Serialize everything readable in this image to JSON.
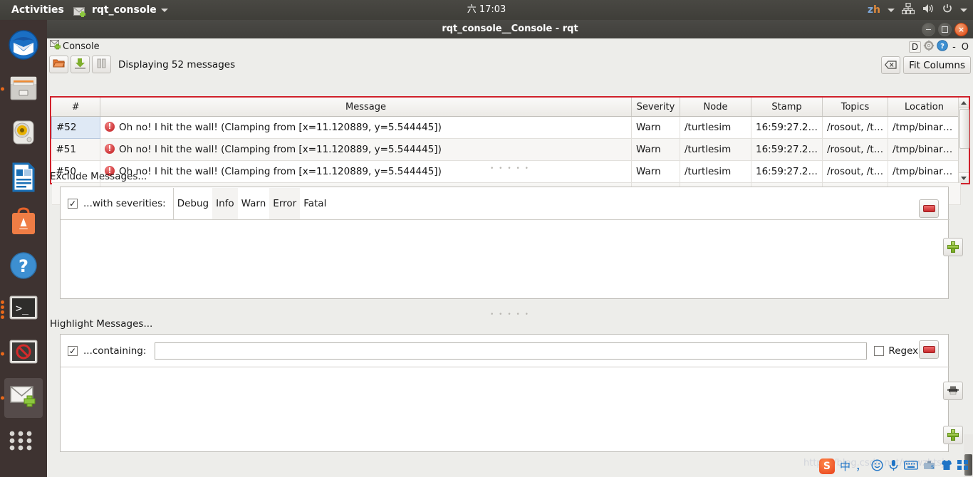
{
  "top_panel": {
    "activities": "Activities",
    "app_name": "rqt_console",
    "app_icon": "mail-add-icon",
    "clock": "六 17:03",
    "language": "zh",
    "tray_icons": [
      "network-icon",
      "volume-icon",
      "power-icon"
    ]
  },
  "launcher": {
    "items": [
      {
        "name": "thunderbird",
        "icon": "thunderbird-icon",
        "running": false,
        "current": false
      },
      {
        "name": "files",
        "icon": "file-manager-icon",
        "running": true,
        "current": false
      },
      {
        "name": "rhythmbox",
        "icon": "rhythmbox-icon",
        "running": false,
        "current": false
      },
      {
        "name": "libreoffice",
        "icon": "libreoffice-writer-icon",
        "running": false,
        "current": false
      },
      {
        "name": "ubuntu-software",
        "icon": "ubuntu-software-icon",
        "running": false,
        "current": false
      },
      {
        "name": "help",
        "icon": "help-icon",
        "running": false,
        "current": false
      },
      {
        "name": "terminal",
        "icon": "terminal-icon",
        "running": true,
        "current": false
      },
      {
        "name": "blocked-app",
        "icon": "no-entry-icon",
        "running": true,
        "current": false
      },
      {
        "name": "rqt-console",
        "icon": "mail-add-icon",
        "running": true,
        "current": true
      },
      {
        "name": "show-applications",
        "icon": "apps-grid-icon",
        "running": false,
        "current": false
      }
    ]
  },
  "window": {
    "title": "rqt_console__Console - rqt",
    "controls": {
      "minimize": "minimize-button",
      "maximize": "maximize-button",
      "close": "close-button"
    }
  },
  "dock": {
    "tab_label": "Console",
    "tab_icon": "mail-add-icon",
    "right_icons": [
      "D",
      "gear-icon",
      "help-icon"
    ],
    "minimize_label": "-",
    "close_label": "O"
  },
  "toolbar": {
    "open_label": "open-icon",
    "save_label": "save-icon",
    "pause_label": "pause-icon",
    "status": "Displaying 52 messages",
    "clear_label": "clear-icon",
    "fit_columns": "Fit Columns"
  },
  "table": {
    "columns": [
      "#",
      "Message",
      "Severity",
      "Node",
      "Stamp",
      "Topics",
      "Location"
    ],
    "rows": [
      {
        "num": "#52",
        "message": "Oh no! I hit the wall! (Clamping from [x=11.120889, y=5.544445])",
        "severity": "Warn",
        "node": "/turtlesim",
        "stamp": "16:59:27.2…",
        "topics": "/rosout, /t…",
        "location": "/tmp/binar…",
        "selected": true
      },
      {
        "num": "#51",
        "message": "Oh no! I hit the wall! (Clamping from [x=11.120889, y=5.544445])",
        "severity": "Warn",
        "node": "/turtlesim",
        "stamp": "16:59:27.2…",
        "topics": "/rosout, /t…",
        "location": "/tmp/binar…",
        "selected": false
      },
      {
        "num": "#50",
        "message": "Oh no! I hit the wall! (Clamping from [x=11.120889, y=5.544445])",
        "severity": "Warn",
        "node": "/turtlesim",
        "stamp": "16:59:27.2…",
        "topics": "/rosout, /t…",
        "location": "/tmp/binar…",
        "selected": false
      }
    ]
  },
  "exclude": {
    "title": "Exclude Messages...",
    "checkbox_checked": true,
    "filter_label": "...with severities:",
    "severities": [
      "Debug",
      "Info",
      "Warn",
      "Error",
      "Fatal"
    ],
    "remove_button": "remove-filter-button",
    "add_button": "add-filter-button"
  },
  "highlight": {
    "title": "Highlight Messages...",
    "checkbox_checked": true,
    "filter_label": "...containing:",
    "input_value": "",
    "regex_label": "Regex",
    "regex_checked": false,
    "remove_button": "remove-filter-button",
    "extra_button": "message-filter-button",
    "add_button": "add-filter-button"
  },
  "tray": {
    "watermark": "https://blog.csdn.net/wzwzhtsj",
    "items": [
      "sogou-logo",
      "中",
      "，",
      "smiley-icon",
      "microphone-icon",
      "keyboard-icon",
      "toolbox-icon",
      "shirt-icon",
      "grid-icon"
    ]
  },
  "colors": {
    "accent_red": "#d0202a",
    "warn_text": "#8f8215",
    "close_button": "#dd4814",
    "panel_bg": "#ededea"
  }
}
